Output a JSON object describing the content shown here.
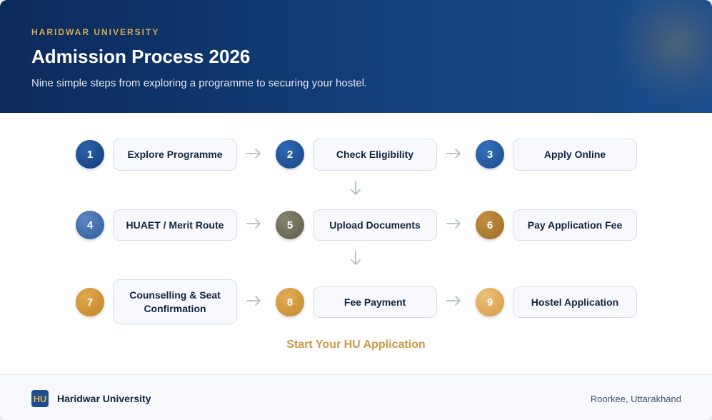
{
  "header": {
    "eyebrow": "HARIDWAR UNIVERSITY",
    "title": "Admission Process 2026",
    "subtitle": "Nine simple steps from exploring a programme to securing your hostel."
  },
  "steps": [
    {
      "number": "1",
      "label": "Explore Programme"
    },
    {
      "number": "2",
      "label": "Check Eligibility"
    },
    {
      "number": "3",
      "label": "Apply Online"
    },
    {
      "number": "4",
      "label": "HUAET / Merit Route"
    },
    {
      "number": "5",
      "label": "Upload Documents"
    },
    {
      "number": "6",
      "label": "Pay Application Fee"
    },
    {
      "number": "7",
      "label": "Counselling & Seat Confirmation"
    },
    {
      "number": "8",
      "label": "Fee Payment"
    },
    {
      "number": "9",
      "label": "Hostel Application"
    }
  ],
  "cta": {
    "label": "Start Your HU Application"
  },
  "footer": {
    "logo_text": "HU",
    "name": "Haridwar University",
    "location": "Roorkee, Uttarakhand"
  },
  "colors": {
    "header_dark": "#0b2a5a",
    "accent_gold": "#c99a45",
    "node_1": "#1a4a8a",
    "node_5": "#6f6c57",
    "node_9": "#e0a85a"
  }
}
